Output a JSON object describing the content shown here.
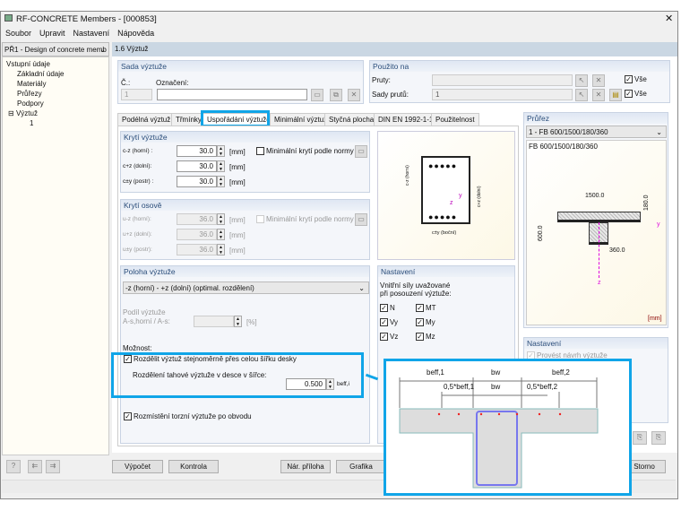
{
  "window": {
    "title": "RF-CONCRETE Members - [000853]",
    "close": "✕"
  },
  "menu": [
    "Soubor",
    "Upravit",
    "Nastavení",
    "Nápověda"
  ],
  "case_select": "PŘ1 - Design of concrete memb",
  "tree": {
    "root": "Vstupní údaje",
    "items": [
      "Základní údaje",
      "Materiály",
      "Průřezy",
      "Podpory"
    ],
    "group": "Výztuž",
    "child": "1"
  },
  "header": "1.6 Výztuž",
  "sada": {
    "title": "Sada výztuže",
    "no_label": "Č.:",
    "no_value": "1",
    "name_label": "Označení:",
    "name_value": ""
  },
  "pouzito": {
    "title": "Použito na",
    "pruty_label": "Pruty:",
    "pruty_value": "",
    "sady_label": "Sady prutů:",
    "sady_value": "1",
    "vse": "Vše"
  },
  "tabs": [
    "Podélná výztuž",
    "Třmínky",
    "Uspořádání výztuže",
    "Minimální výztuž",
    "Styčná plocha",
    "DIN EN 1992-1-1",
    "Použitelnost"
  ],
  "kryti": {
    "title": "Krytí výztuže",
    "rows": [
      {
        "label": "c-z (horní) :",
        "value": "30.0"
      },
      {
        "label": "c+z (dolní):",
        "value": "30.0"
      },
      {
        "label": "c±y (postr) :",
        "value": "30.0"
      }
    ],
    "unit": "[mm]",
    "min": "Minimální krytí podle normy"
  },
  "osove": {
    "title": "Krytí osově",
    "rows": [
      {
        "label": "u-z (horní):",
        "value": "36.0"
      },
      {
        "label": "u+z (dolní):",
        "value": "36.0"
      },
      {
        "label": "u±y (postr):",
        "value": "36.0"
      }
    ],
    "unit": "[mm]",
    "min": "Minimální krytí podle normy"
  },
  "sketch": {
    "c_top": "c-z (horní)",
    "c_bot": "c+z (dolní)",
    "c_side": "c±y (boční)",
    "y": "y",
    "z": "z"
  },
  "poloha": {
    "title": "Poloha výztuže",
    "select": "-z (horní) - +z (dolní) (optimal. rozdělení)",
    "podil1": "Podíl výztuže",
    "podil2": "A-s,horní / A-s:",
    "podil_unit": "[%]",
    "moznost": "Možnost:",
    "rozdelit": "Rozdělit výztuž stejnoměrně přes celou šířku desky",
    "rozdeleni": "Rozdělení tahové výztuže v desce v šířce:",
    "rozdeleni_value": "0.500",
    "rozdeleni_unit": "beff,i",
    "torzni": "Rozmístění torzní výztuže po obvodu"
  },
  "nastaveni": {
    "title": "Nastavení",
    "text1": "Vnitřní síly uvažované",
    "text2": "při posouzení výztuže:",
    "forces": [
      "N",
      "MT",
      "Vy",
      "My",
      "Vz",
      "Mz"
    ]
  },
  "prurez": {
    "title": "Průřez",
    "select": "1 - FB 600/1500/180/360",
    "name": "FB 600/1500/180/360",
    "b": "1500.0",
    "t": "180.0",
    "h": "600.0",
    "bw": "360.0",
    "y": "y",
    "z": "z",
    "unit": "[mm]"
  },
  "nastaveni2": {
    "title": "Nastavení",
    "navrh": "Provést návrh výztuže"
  },
  "buttons": {
    "vypocet": "Výpočet",
    "kontrola": "Kontrola",
    "nar": "Nár. příloha",
    "grafika": "Grafika",
    "storno": "Storno"
  },
  "overlay": {
    "beff1": "beff,1",
    "bw": "bw",
    "beff2": "beff,2",
    "half1": "0,5*beff,1",
    "half2": "0,5*beff,2"
  },
  "accent": "#10a5e8"
}
